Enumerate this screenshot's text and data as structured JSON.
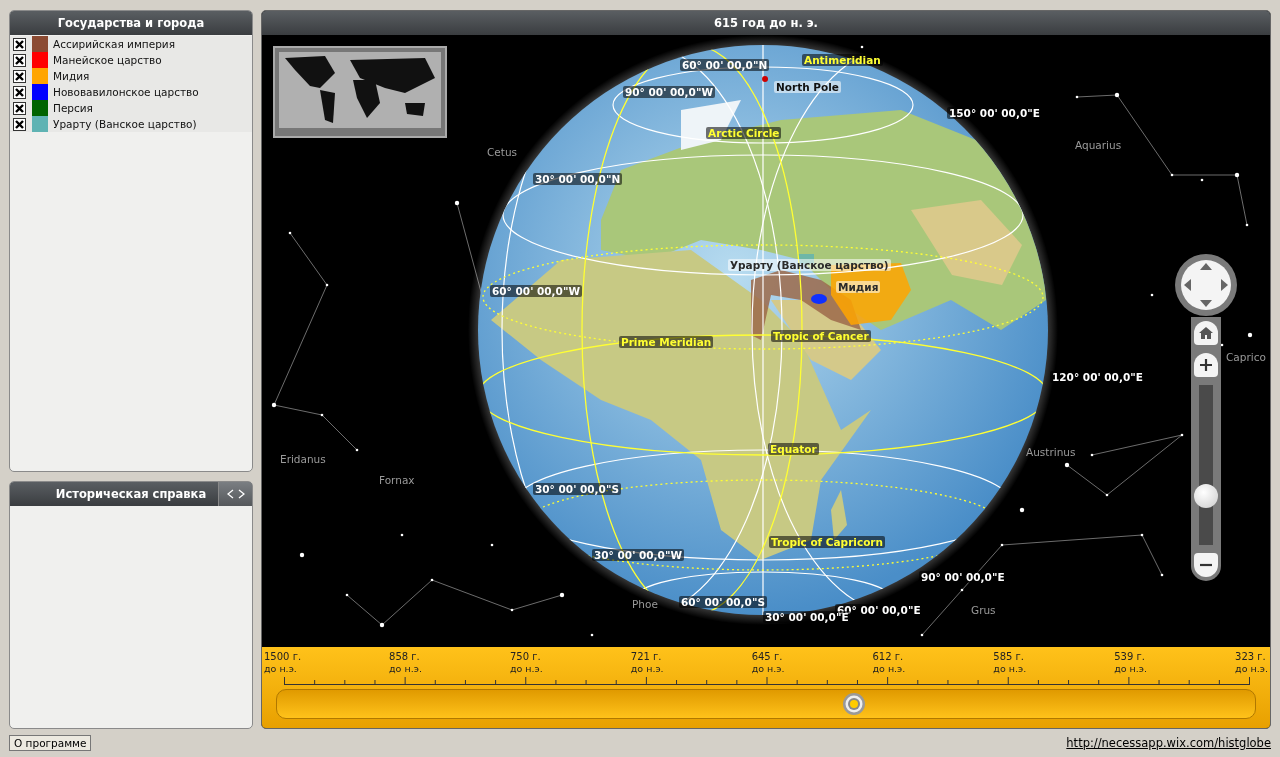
{
  "legend": {
    "title": "Государства и города",
    "items": [
      {
        "label": "Ассирийская империя",
        "color": "#8b4a32",
        "checked": true
      },
      {
        "label": "Манейское царство",
        "color": "#ff0000",
        "checked": true
      },
      {
        "label": "Мидия",
        "color": "#ffa500",
        "checked": true
      },
      {
        "label": "Нововавилонское царство",
        "color": "#0000ff",
        "checked": true
      },
      {
        "label": "Персия",
        "color": "#006400",
        "checked": true
      },
      {
        "label": "Урарту (Ванское царство)",
        "color": "#5fb3b3",
        "checked": true
      }
    ]
  },
  "info_panel": {
    "title": "Историческая справка"
  },
  "map": {
    "title": "615 год до н. э.",
    "zoom": {
      "level": 0.27
    },
    "labels": [
      {
        "text": "60° 00' 00,0\"N",
        "kind": "grid"
      },
      {
        "text": "Antimeridian",
        "kind": "circle"
      },
      {
        "text": "90° 00' 00,0\"W",
        "kind": "grid"
      },
      {
        "text": "North Pole",
        "kind": "pole"
      },
      {
        "text": "150° 00' 00,0\"E",
        "kind": "grid"
      },
      {
        "text": "Arctic Circle",
        "kind": "circle"
      },
      {
        "text": "Cetus",
        "kind": "constellation"
      },
      {
        "text": "Aquarius",
        "kind": "constellation"
      },
      {
        "text": "30° 00' 00,0\"N",
        "kind": "grid"
      },
      {
        "text": "Урарту (Ванское царство)",
        "kind": "region"
      },
      {
        "text": "Мидия",
        "kind": "region"
      },
      {
        "text": "60° 00' 00,0\"W",
        "kind": "grid"
      },
      {
        "text": "Prime Meridian",
        "kind": "circle"
      },
      {
        "text": "Tropic of Cancer",
        "kind": "circle"
      },
      {
        "text": "120° 00' 00,0\"E",
        "kind": "grid"
      },
      {
        "text": "Caprico",
        "kind": "constellation"
      },
      {
        "text": "Eridanus",
        "kind": "constellation"
      },
      {
        "text": "Fornax",
        "kind": "constellation"
      },
      {
        "text": "Equator",
        "kind": "circle"
      },
      {
        "text": "Austrinus",
        "kind": "constellation"
      },
      {
        "text": "30° 00' 00,0\"S",
        "kind": "grid"
      },
      {
        "text": "Tropic of Capricorn",
        "kind": "circle"
      },
      {
        "text": "30° 00' 00,0\"W",
        "kind": "grid"
      },
      {
        "text": "90° 00' 00,0\"E",
        "kind": "grid"
      },
      {
        "text": "Phoe",
        "kind": "constellation"
      },
      {
        "text": "60° 00' 00,0\"S",
        "kind": "grid"
      },
      {
        "text": "60° 00' 00,0\"E",
        "kind": "grid"
      },
      {
        "text": "Grus",
        "kind": "constellation"
      },
      {
        "text": "30° 00' 00,0\"E",
        "kind": "grid"
      }
    ]
  },
  "timeline": {
    "level": 0.59,
    "ticks": [
      {
        "year": "1500 г.",
        "era": "до н.э."
      },
      {
        "year": "858 г.",
        "era": "до н.э."
      },
      {
        "year": "750 г.",
        "era": "до н.э."
      },
      {
        "year": "721 г.",
        "era": "до н.э."
      },
      {
        "year": "645 г.",
        "era": "до н.э."
      },
      {
        "year": "612 г.",
        "era": "до н.э."
      },
      {
        "year": "585 г.",
        "era": "до н.э."
      },
      {
        "year": "539 г.",
        "era": "до н.э."
      },
      {
        "year": "323 г.",
        "era": "до н.э."
      }
    ]
  },
  "about_button": "О программе",
  "link": "http://necessapp.wix.com/histglobe"
}
